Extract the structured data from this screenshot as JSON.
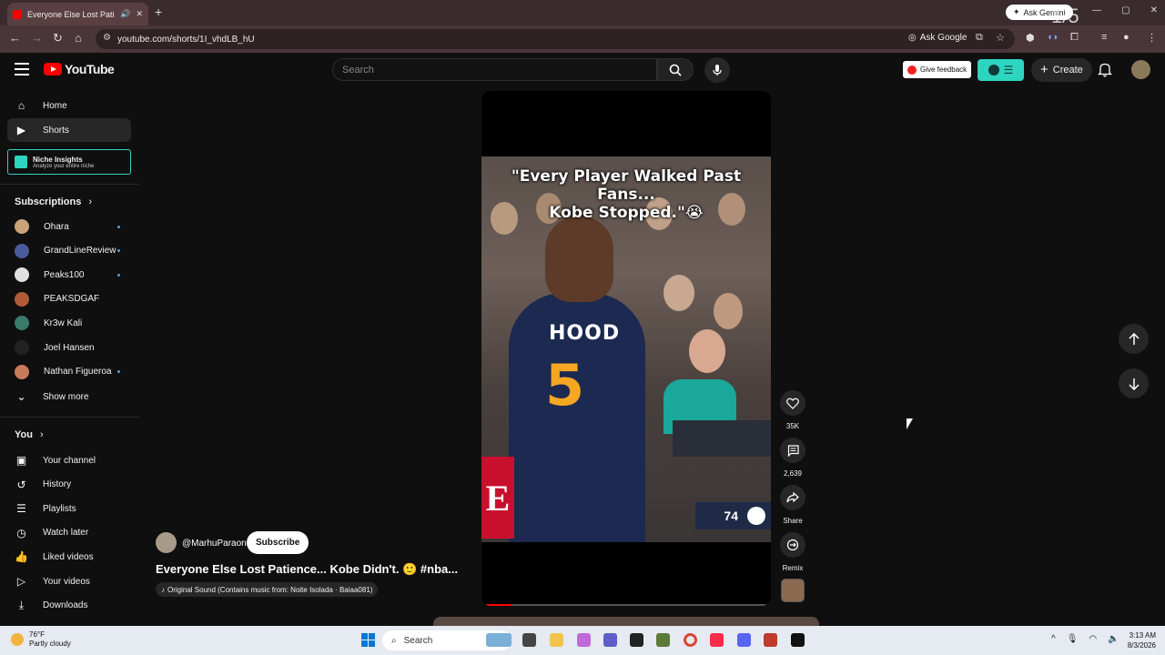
{
  "browser": {
    "tab_title": "Everyone Else Lost Patience",
    "new_tab": "+",
    "ask_gemini": "Ask Gemini",
    "overlay_counter": "1/5",
    "url": "youtube.com/shorts/1I_vhdLB_hU",
    "ask_google": "Ask Google"
  },
  "header": {
    "logo_text": "YouTube",
    "search_placeholder": "Search",
    "give_feedback": "Give feedback",
    "create": "Create"
  },
  "sidebar": {
    "main": [
      {
        "label": "Home",
        "icon": "home-icon"
      },
      {
        "label": "Shorts",
        "icon": "shorts-icon",
        "active": true
      }
    ],
    "niche": {
      "title": "Niche Insights",
      "subtitle": "Analyze your entire niche"
    },
    "subscriptions_heading": "Subscriptions",
    "subscriptions": [
      {
        "label": "Ohara",
        "new": true,
        "color": "#c9a37a"
      },
      {
        "label": "GrandLineReview",
        "new": true,
        "color": "#4a5a9a"
      },
      {
        "label": "Peaks100",
        "new": true,
        "color": "#e0e0e0"
      },
      {
        "label": "PEAKSDGAF",
        "new": false,
        "color": "#b05a3a"
      },
      {
        "label": "Kr3w Kali",
        "new": false,
        "color": "#3a7a6a"
      },
      {
        "label": "Joel Hansen",
        "new": false,
        "color": "#222222"
      },
      {
        "label": "Nathan Figueroa",
        "new": true,
        "color": "#c87a5a"
      }
    ],
    "show_more": "Show more",
    "you_heading": "You",
    "you_items": [
      {
        "label": "Your channel",
        "icon": "channel-icon"
      },
      {
        "label": "History",
        "icon": "history-icon"
      },
      {
        "label": "Playlists",
        "icon": "playlists-icon"
      },
      {
        "label": "Watch later",
        "icon": "watch-later-icon"
      },
      {
        "label": "Liked videos",
        "icon": "like-icon"
      },
      {
        "label": "Your videos",
        "icon": "your-videos-icon"
      },
      {
        "label": "Downloads",
        "icon": "download-icon"
      }
    ]
  },
  "video": {
    "caption_line1": "\"Every Player Walked Past Fans...",
    "caption_line2": "Kobe Stopped.\"😭",
    "jersey_name": "HOOD",
    "jersey_number": "5",
    "score": "74",
    "e_logo": "E",
    "progress": 0.09
  },
  "actions": {
    "likes": "35K",
    "comments": "2,639",
    "share": "Share",
    "remix": "Remix"
  },
  "channel": {
    "handle": "@MarhuParaon",
    "subscribe": "Subscribe",
    "title": "Everyone Else Lost Patience... Kobe Didn't. 🙂 #nba...",
    "sound": "Original Sound (Contains music from: Noite Isolada · Baiaa081)"
  },
  "taskbar": {
    "temp": "76°F",
    "weather": "Partly cloudy",
    "search": "Search",
    "time": "3:13 AM",
    "date": "8/3/2026"
  },
  "colors": {
    "accent": "#ff0000",
    "niche": "#2dd4bf",
    "bg": "#0f0f0f"
  }
}
